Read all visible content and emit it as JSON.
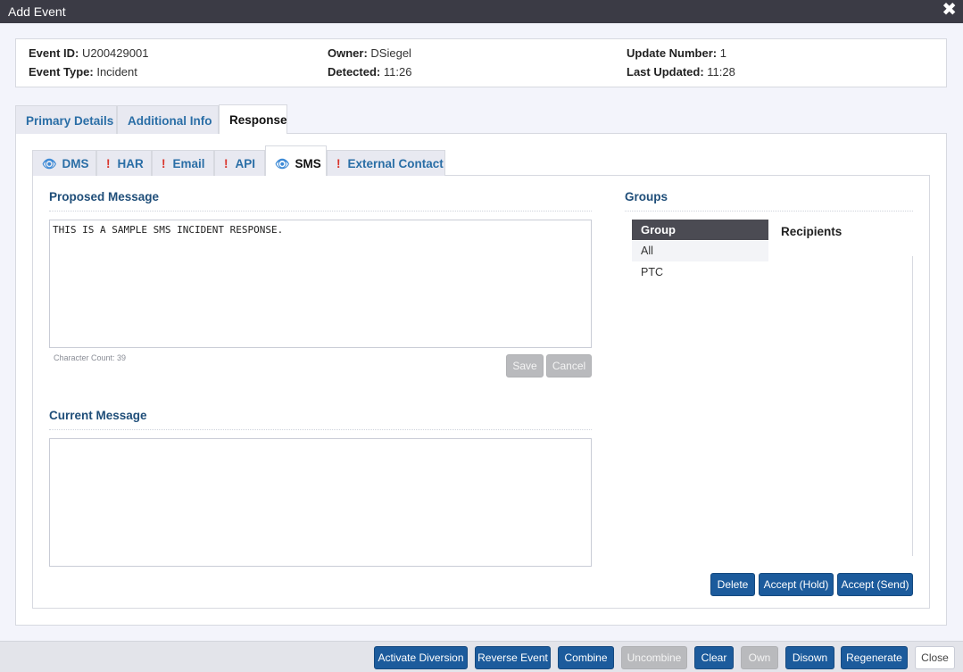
{
  "window": {
    "title": "Add Event",
    "close_glyph": "✖"
  },
  "info": {
    "event_id_label": "Event ID:",
    "event_id": "U200429001",
    "event_type_label": "Event Type:",
    "event_type": "Incident",
    "owner_label": "Owner:",
    "owner": "DSiegel",
    "detected_label": "Detected:",
    "detected": "11:26",
    "update_number_label": "Update Number:",
    "update_number": "1",
    "last_updated_label": "Last Updated:",
    "last_updated": "11:28"
  },
  "main_tabs": [
    {
      "label": "Primary Details",
      "active": false
    },
    {
      "label": "Additional Info",
      "active": false
    },
    {
      "label": "Response",
      "active": true
    }
  ],
  "sub_tabs": [
    {
      "label": "DMS",
      "icon": "eye-icon",
      "glyph": "👁"
    },
    {
      "label": "HAR",
      "icon": "warning-icon",
      "glyph": "!"
    },
    {
      "label": "Email",
      "icon": "warning-icon",
      "glyph": "!"
    },
    {
      "label": "API",
      "icon": "warning-icon",
      "glyph": "!"
    },
    {
      "label": "SMS",
      "icon": "eye-icon",
      "glyph": "👁",
      "active": true
    },
    {
      "label": "External Contact",
      "icon": "warning-icon",
      "glyph": "!"
    }
  ],
  "proposed": {
    "title": "Proposed Message",
    "text": "THIS IS A SAMPLE SMS INCIDENT RESPONSE.",
    "char_count": "Character Count: 39",
    "save_label": "Save",
    "cancel_label": "Cancel"
  },
  "current": {
    "title": "Current Message",
    "text": ""
  },
  "groups": {
    "title": "Groups",
    "header": "Group",
    "rows": [
      "All",
      "PTC"
    ],
    "recipients_label": "Recipients",
    "delete_label": "Delete",
    "accept_hold_label": "Accept (Hold)",
    "accept_send_label": "Accept (Send)"
  },
  "footer": {
    "activate_diversion": "Activate Diversion",
    "reverse_event": "Reverse Event",
    "combine": "Combine",
    "uncombine": "Uncombine",
    "clear": "Clear",
    "own": "Own",
    "disown": "Disown",
    "regenerate": "Regenerate",
    "close": "Close"
  },
  "colors": {
    "accent": "#1c5b9c",
    "tab_text": "#2a6ea6",
    "section_title": "#1f4e79",
    "warning": "#d9342b",
    "eye": "#3d8ad6"
  }
}
